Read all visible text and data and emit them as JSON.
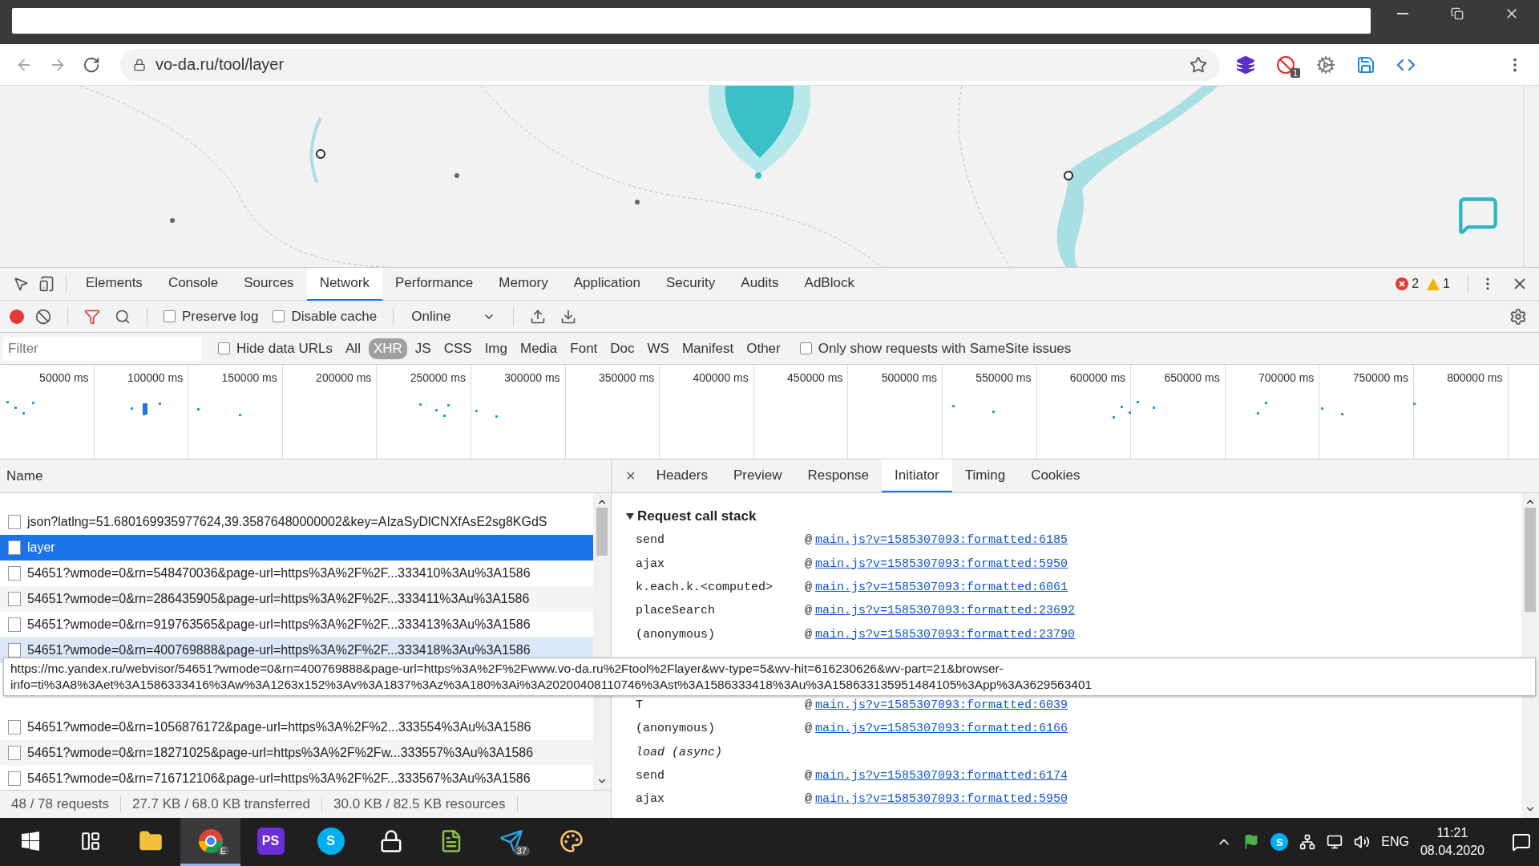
{
  "browser": {
    "url": "vo-da.ru/tool/layer",
    "extension_badge": "1"
  },
  "devtools": {
    "tabs": [
      {
        "label": "Elements",
        "selected": false
      },
      {
        "label": "Console",
        "selected": false
      },
      {
        "label": "Sources",
        "selected": false
      },
      {
        "label": "Network",
        "selected": true
      },
      {
        "label": "Performance",
        "selected": false
      },
      {
        "label": "Memory",
        "selected": false
      },
      {
        "label": "Application",
        "selected": false
      },
      {
        "label": "Security",
        "selected": false
      },
      {
        "label": "Audits",
        "selected": false
      },
      {
        "label": "AdBlock",
        "selected": false
      }
    ],
    "errors": "2",
    "warnings": "1",
    "toolbar": {
      "recording": true,
      "filter_active": true,
      "checkboxes": [
        {
          "label": "Preserve log",
          "checked": false
        },
        {
          "label": "Disable cache",
          "checked": false
        }
      ],
      "throttling": "Online"
    },
    "filter": {
      "placeholder": "Filter",
      "hide_data_urls": {
        "label": "Hide data URLs",
        "checked": false
      },
      "types": [
        {
          "label": "All",
          "selected": false
        },
        {
          "label": "XHR",
          "selected": true
        },
        {
          "label": "JS",
          "selected": false
        },
        {
          "label": "CSS",
          "selected": false
        },
        {
          "label": "Img",
          "selected": false
        },
        {
          "label": "Media",
          "selected": false
        },
        {
          "label": "Font",
          "selected": false
        },
        {
          "label": "Doc",
          "selected": false
        },
        {
          "label": "WS",
          "selected": false
        },
        {
          "label": "Manifest",
          "selected": false
        },
        {
          "label": "Other",
          "selected": false
        }
      ],
      "samesite": {
        "label": "Only show requests with SameSite issues",
        "checked": false
      }
    },
    "timeline": {
      "ticks": [
        "50000 ms",
        "100000 ms",
        "150000 ms",
        "200000 ms",
        "250000 ms",
        "300000 ms",
        "350000 ms",
        "400000 ms",
        "450000 ms",
        "500000 ms",
        "550000 ms",
        "600000 ms",
        "650000 ms",
        "700000 ms",
        "750000 ms",
        "800000 ms"
      ]
    },
    "requests": {
      "column": "Name",
      "rows": [
        {
          "kind": "request",
          "name": "json?latlng=51.680169935977624,39.35876480000002&key=AIzaSyDlCNXfAsE2sg8KGdS",
          "selected": false,
          "hovered": false
        },
        {
          "kind": "request",
          "name": "layer",
          "selected": true,
          "hovered": false
        },
        {
          "kind": "request",
          "name": "54651?wmode=0&rn=548470036&page-url=https%3A%2F%2F...333410%3Au%3A1586",
          "selected": false,
          "hovered": false
        },
        {
          "kind": "request",
          "name": "54651?wmode=0&rn=286435905&page-url=https%3A%2F%2F...333411%3Au%3A1586",
          "selected": false,
          "hovered": false
        },
        {
          "kind": "request",
          "name": "54651?wmode=0&rn=919763565&page-url=https%3A%2F%2F...333413%3Au%3A1586",
          "selected": false,
          "hovered": false
        },
        {
          "kind": "request",
          "name": "54651?wmode=0&rn=400769888&page-url=https%3A%2F%2F...333418%3Au%3A1586",
          "selected": false,
          "hovered": true
        },
        {
          "kind": "covered"
        },
        {
          "kind": "covered"
        },
        {
          "kind": "request",
          "name": "54651?wmode=0&rn=1056876172&page-url=https%3A%2F%2...333554%3Au%3A1586",
          "selected": false,
          "hovered": false
        },
        {
          "kind": "request",
          "name": "54651?wmode=0&rn=18271025&page-url=https%3A%2F%2Fw...333557%3Au%3A1586",
          "selected": false,
          "hovered": false
        },
        {
          "kind": "request",
          "name": "54651?wmode=0&rn=716712106&page-url=https%3A%2F%2F...333567%3Au%3A1586",
          "selected": false,
          "hovered": false
        }
      ],
      "status": [
        "48 / 78 requests",
        "27.7 KB / 68.0 KB transferred",
        "30.0 KB / 82.5 KB resources"
      ]
    },
    "details": {
      "close": "×",
      "tabs": [
        {
          "label": "Headers",
          "selected": false
        },
        {
          "label": "Preview",
          "selected": false
        },
        {
          "label": "Response",
          "selected": false
        },
        {
          "label": "Initiator",
          "selected": true
        },
        {
          "label": "Timing",
          "selected": false
        },
        {
          "label": "Cookies",
          "selected": false
        }
      ],
      "section": "Request call stack",
      "expanded": true,
      "separator": "@",
      "frames": [
        {
          "kind": "frame",
          "fn": "send",
          "link": "main.js?v=1585307093:formatted:6185"
        },
        {
          "kind": "frame",
          "fn": "ajax",
          "link": "main.js?v=1585307093:formatted:5950"
        },
        {
          "kind": "frame",
          "fn": "k.each.k.<computed>",
          "link": "main.js?v=1585307093:formatted:6061"
        },
        {
          "kind": "frame",
          "fn": "placeSearch",
          "link": "main.js?v=1585307093:formatted:23692"
        },
        {
          "kind": "frame",
          "fn": "(anonymous)",
          "link": "main.js?v=1585307093:formatted:23790"
        },
        {
          "kind": "covered"
        },
        {
          "kind": "covered"
        },
        {
          "kind": "frame",
          "fn": "T",
          "link": "main.js?v=1585307093:formatted:6039"
        },
        {
          "kind": "frame",
          "fn": "(anonymous)",
          "link": "main.js?v=1585307093:formatted:6166"
        },
        {
          "kind": "async",
          "fn": "load (async)"
        },
        {
          "kind": "frame",
          "fn": "send",
          "link": "main.js?v=1585307093:formatted:6174"
        },
        {
          "kind": "frame",
          "fn": "ajax",
          "link": "main.js?v=1585307093:formatted:5950"
        }
      ]
    },
    "tooltip": [
      "https://mc.yandex.ru/webvisor/54651?wmode=0&rn=400769888&page-url=https%3A%2F%2Fwww.vo-da.ru%2Ftool%2Flayer&wv-type=5&wv-hit=616230626&wv-part=21&browser-",
      "info=ti%3A8%3Aet%3A1586333416%3Aw%3A1263x152%3Av%3A1837%3Az%3A180%3Ai%3A20200408110746%3Ast%3A1586333418%3Au%3A158633135951484105%3App%3A3629563401"
    ]
  },
  "taskbar": {
    "apps": [
      {
        "kind": "start",
        "active": false
      },
      {
        "kind": "taskview",
        "active": false
      },
      {
        "kind": "explorer",
        "active": false
      },
      {
        "kind": "chrome",
        "active": true,
        "badge": "E"
      },
      {
        "kind": "phpstorm",
        "active": false,
        "label": "PS"
      },
      {
        "kind": "skype",
        "active": false,
        "label": "S"
      },
      {
        "kind": "keepass",
        "active": false
      },
      {
        "kind": "notepad",
        "active": false
      },
      {
        "kind": "telegram",
        "active": false,
        "badge": "37"
      },
      {
        "kind": "paint",
        "active": false
      }
    ],
    "tray_skype": "S",
    "language": "ENG",
    "time": "11:21",
    "date": "08.04.2020"
  }
}
